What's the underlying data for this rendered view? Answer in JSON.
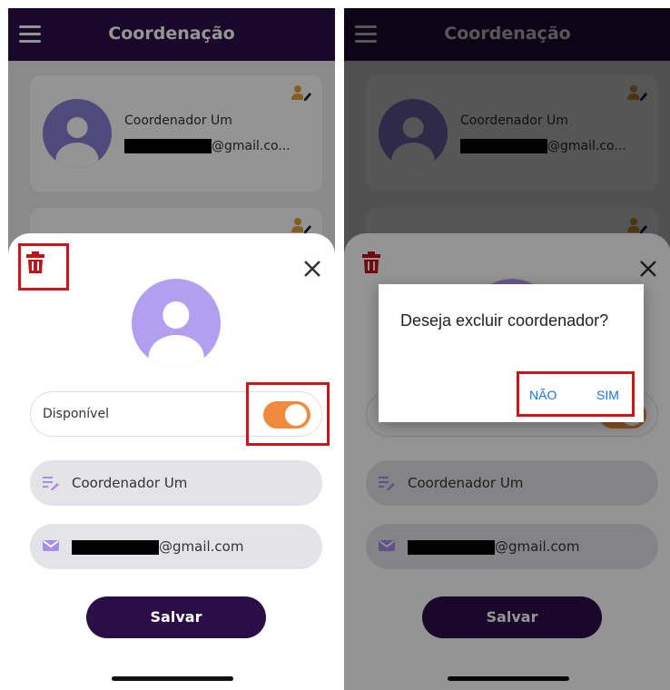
{
  "header": {
    "title": "Coordenação"
  },
  "card": {
    "name": "Coordenador Um",
    "email_suffix": "@gmail.co..."
  },
  "sheet": {
    "available_label": "Disponível",
    "available_on": true,
    "name_value": "Coordenador Um",
    "email_suffix": "@gmail.com",
    "save_label": "Salvar"
  },
  "dialog": {
    "message": "Deseja excluir coordenador?",
    "cancel_label": "NÃO",
    "confirm_label": "SIM"
  },
  "colors": {
    "primary": "#2b0e48",
    "toggle": "#f08a3c",
    "highlight": "#d0141a",
    "trash": "#c0141a",
    "dialog_button": "#1a73e8"
  },
  "icons": [
    "menu-icon",
    "edit-user-icon",
    "avatar-icon",
    "trash-icon",
    "close-icon",
    "notes-edit-icon",
    "mail-icon"
  ]
}
